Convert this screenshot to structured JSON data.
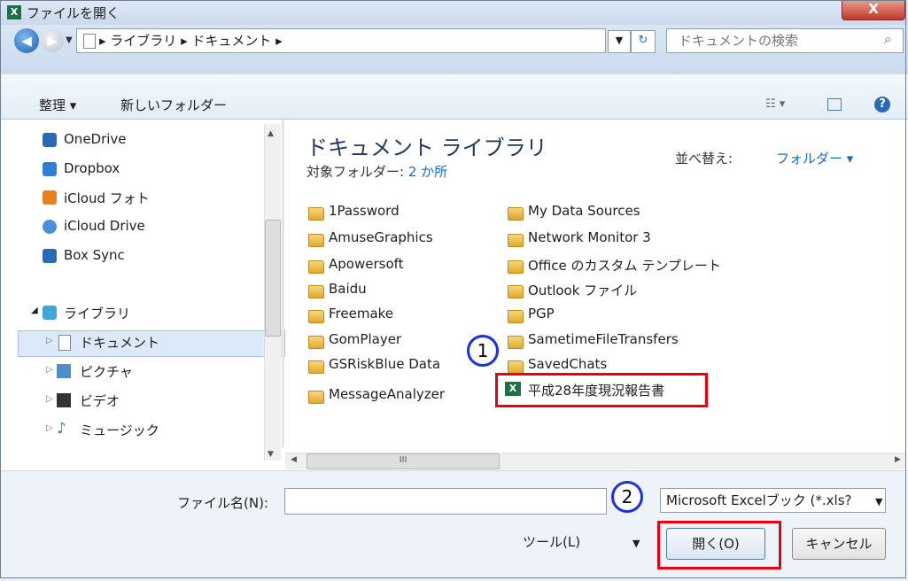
{
  "title_bar": {
    "app_icon": "X",
    "title": "ファイルを開く",
    "close_label": "X"
  },
  "address_bar": {
    "breadcrumb": "▸ ライブラリ ▸ ドキュメント ▸",
    "search_placeholder": "ドキュメントの検索"
  },
  "toolbar": {
    "organize": "整理 ▾",
    "new_folder": "新しいフォルダー"
  },
  "nav": {
    "items": [
      {
        "label": "OneDrive",
        "icon": "onedrive-icon",
        "color": "#2a6ab5"
      },
      {
        "label": "Dropbox",
        "icon": "dropbox-icon",
        "color": "#2d7fd8"
      },
      {
        "label": "iCloud フォト",
        "icon": "icloud-photos-icon",
        "color": "#e6821e"
      },
      {
        "label": "iCloud Drive",
        "icon": "icloud-drive-icon",
        "color": "#4a90d9"
      },
      {
        "label": "Box Sync",
        "icon": "box-icon",
        "color": "#2a6ab5"
      },
      {
        "label": "ライブラリ",
        "icon": "library-icon",
        "color": "#3fa8d6"
      },
      {
        "label": "ドキュメント",
        "icon": "document-icon",
        "color": "#7a8797"
      },
      {
        "label": "ピクチャ",
        "icon": "picture-icon",
        "color": "#4c8fc9"
      },
      {
        "label": "ビデオ",
        "icon": "video-icon",
        "color": "#333333"
      },
      {
        "label": "ミュージック",
        "icon": "music-icon",
        "color": "#2a7fd1"
      }
    ]
  },
  "library": {
    "title": "ドキュメント ライブラリ",
    "subtitle_prefix": "対象フォルダー: ",
    "subtitle_link": "2 か所",
    "sort_label": "並べ替え:",
    "sort_value": "フォルダー ▾"
  },
  "files": {
    "col1": [
      "1Password",
      "AmuseGraphics",
      "Apowersoft",
      "Baidu",
      "Freemake",
      "GomPlayer",
      "GSRiskBlue Data",
      "MessageAnalyzer"
    ],
    "col2": [
      "My Data Sources",
      "Network Monitor 3",
      "Office のカスタム テンプレート",
      "Outlook ファイル",
      "PGP",
      "SametimeFileTransfers",
      "SavedChats"
    ],
    "highlighted_file": "平成28年度現況報告書"
  },
  "scrollbar": {
    "thumb_grip": "III"
  },
  "bottom": {
    "filename_label": "ファイル名(N):",
    "filename_value": "",
    "filter": "Microsoft Excelブック (*.xls?",
    "tools": "ツール(L)",
    "open": "開く(O)",
    "cancel": "キャンセル"
  },
  "callouts": {
    "one": "1",
    "two": "2"
  },
  "colors": {
    "highlight_red": "#e60012",
    "callout_blue": "#1a2ee6",
    "link_blue": "#1e6bb8",
    "excel_green": "#1e7145"
  }
}
